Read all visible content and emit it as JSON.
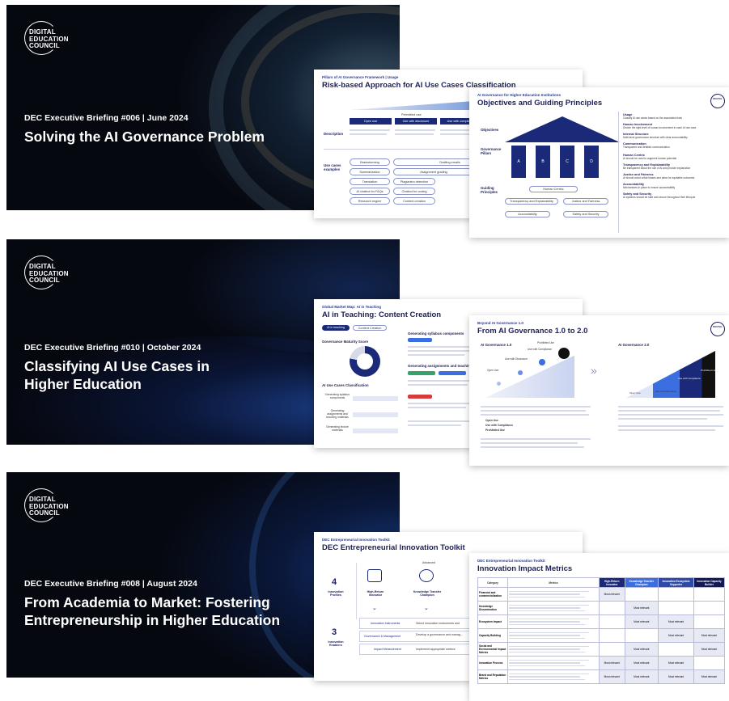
{
  "briefings": [
    {
      "logo": [
        "DIGITAL",
        "EDUCATION",
        "COUNCIL"
      ],
      "eyebrow": "DEC Executive Briefing #006 | June 2024",
      "title": "Solving the AI Governance Problem",
      "slide1": {
        "kicker": "Pillars of AI Governance Framework  |  Usage",
        "title": "Risk-based Approach for AI Use Cases Classification",
        "header_label": "Permitted use",
        "columns": [
          "Open use",
          "Use with disclosure",
          "Use with compliance"
        ],
        "row_labels": [
          "Description",
          "Use cases examples"
        ],
        "examples": [
          "Brainstorming",
          "Drafting emails",
          "Summarization",
          "Assignment grading",
          "Translation",
          "Plagiarism detection",
          "AI chatbot for FAQs",
          "Chatbot for coding",
          "Research engine",
          "Content creation"
        ]
      },
      "slide2": {
        "kicker": "AI Governance for Higher Education Institutions",
        "title": "Objectives and Guiding Principles",
        "objectives_label": "Objectives",
        "pillars_label": "Governance Pillars",
        "principles_label": "Guiding Principles",
        "pillars": [
          "A",
          "B",
          "C",
          "D"
        ],
        "principles": [
          "Human Centric",
          "Transparency and Explainability",
          "Justice and Fairness",
          "Accountability",
          "Safety and Security"
        ],
        "right_items": [
          {
            "title": "Usage",
            "text": "Classify AI use cases based on the associated risks"
          },
          {
            "title": "Human Involvement",
            "text": "Decide the right level of human involvement in each AI use case"
          },
          {
            "title": "Internal Structure",
            "text": "Multi-level governance structure with clear accountability"
          },
          {
            "title": "Communication",
            "text": "Transparent and detailed communication"
          },
          {
            "title": "Human Centric",
            "text": "AI should be used to augment human potential"
          },
          {
            "title": "Transparency and Explainability",
            "text": "Be transparent about the use of AI and provide explanation"
          },
          {
            "title": "Justice and Fairness",
            "text": "AI should avoid unfair biases and allow for equitable outcomes"
          },
          {
            "title": "Accountability",
            "text": "Mechanisms in place to ensure accountability"
          },
          {
            "title": "Safety and Security",
            "text": "AI systems should be safe and secure throughout their lifecycle"
          }
        ]
      }
    },
    {
      "logo": [
        "DIGITAL",
        "EDUCATION",
        "COUNCIL"
      ],
      "eyebrow": "DEC Executive Briefing #010 | October 2024",
      "title": "Classifying AI Use Cases in Higher Education",
      "slide1": {
        "kicker": "Global Market Map: AI in Teaching",
        "title": "AI in Teaching: Content Creation",
        "tabs": [
          "AI in teaching",
          "Content Creation"
        ],
        "maturity_label": "Governance Maturity Score",
        "classification_label": "AI Use Cases Classification",
        "rows": [
          "Generating syllabus components",
          "Generating assignments and teaching materials",
          "Generating lecture materials"
        ],
        "section1": "Generating syllabus components",
        "section2": "Generating assignments and teaching materials"
      },
      "slide2": {
        "kicker": "Beyond AI Governance 1.0",
        "title": "From AI Governance 1.0 to 2.0",
        "left_label": "AI Governance 1.0",
        "right_label": "AI Governance 2.0",
        "left_stages": [
          "Open Use",
          "Use with Disclosure",
          "Use with Compliance",
          "Prohibited Use"
        ],
        "right_stages": [
          "Open Use",
          "Use with Disclosure",
          "Use with Compliance",
          "Prohibited Use"
        ],
        "bullets": [
          "Open Use",
          "Use with Compliance",
          "Prohibited Use"
        ]
      }
    },
    {
      "logo": [
        "DIGITAL",
        "EDUCATION",
        "COUNCIL"
      ],
      "eyebrow": "DEC Executive Briefing #008 | August 2024",
      "title": "From Academia to Market: Fostering Entrepreneurship in Higher Education",
      "slide1": {
        "kicker": "DEC Entrepreneurial Innovation Toolkit",
        "title": "DEC Entrepreneurial Innovation Toolkit",
        "profiles_count": "4",
        "profiles_label": "Innovation Profiles",
        "enablers_count": "3",
        "enablers_label": "Innovation Enablers",
        "profiles": [
          "High-Return Innovator",
          "Knowledge Transfer Champion"
        ],
        "advanced_label": "Advanced",
        "enablers": [
          {
            "name": "Innovation Instruments",
            "text": "Select innovation instruments and"
          },
          {
            "name": "Governance & Management",
            "text": "Develop a governance and manag..."
          },
          {
            "name": "Impact Measurement",
            "text": "Implement appropriate metrics"
          }
        ]
      },
      "slide2": {
        "kicker": "DEC Entrepreneurial Innovation Toolkit",
        "title": "Innovation Impact Metrics",
        "headers": [
          "Category",
          "Metrics",
          "High-Return Innovator",
          "Knowledge Transfer Champion",
          "Innovation Ecosystem Supporter",
          "Innovation Capacity Builder"
        ],
        "categories": [
          "Financial and commercialisation",
          "Knowledge Dissemination",
          "Ecosystem Impact",
          "Capacity Building",
          "Social and Environmental Impact Metrics",
          "Innovation Process",
          "Brand and Reputation Metrics"
        ],
        "relevance_label": "Most relevant",
        "grid": [
          [
            true,
            false,
            false,
            false
          ],
          [
            false,
            true,
            false,
            false
          ],
          [
            false,
            true,
            true,
            false
          ],
          [
            false,
            false,
            true,
            true
          ],
          [
            false,
            true,
            false,
            true
          ],
          [
            true,
            true,
            true,
            false
          ],
          [
            true,
            true,
            true,
            true
          ]
        ]
      }
    }
  ]
}
